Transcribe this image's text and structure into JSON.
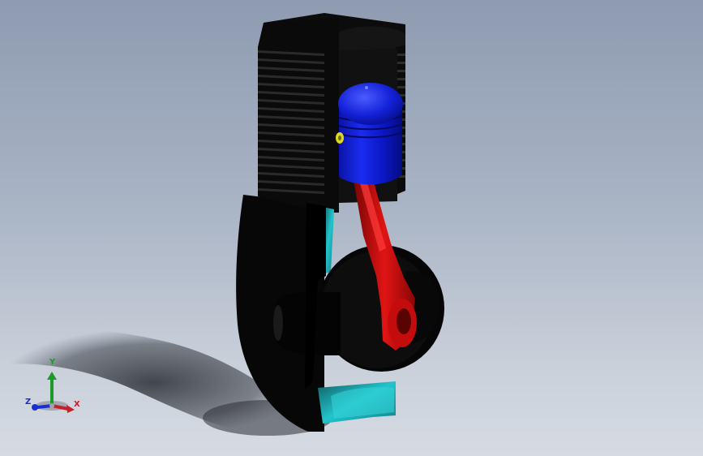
{
  "viewport": {
    "background_top": "#8e9bb0",
    "background_bottom": "#d6dbe3"
  },
  "model": {
    "parts": [
      {
        "name": "cylinder-block",
        "color": "#000000"
      },
      {
        "name": "piston",
        "color": "#0a1ad6"
      },
      {
        "name": "connecting-rod",
        "color": "#d10a0a"
      },
      {
        "name": "crankcase-interior",
        "color": "#1fb7bd"
      },
      {
        "name": "wrist-pin",
        "color": "#d8d21a"
      }
    ]
  },
  "triad": {
    "x_label": "X",
    "y_label": "Y",
    "z_label": "Z",
    "x_color": "#c8202a",
    "y_color": "#1c9a2a",
    "z_color": "#1a2fd0"
  }
}
